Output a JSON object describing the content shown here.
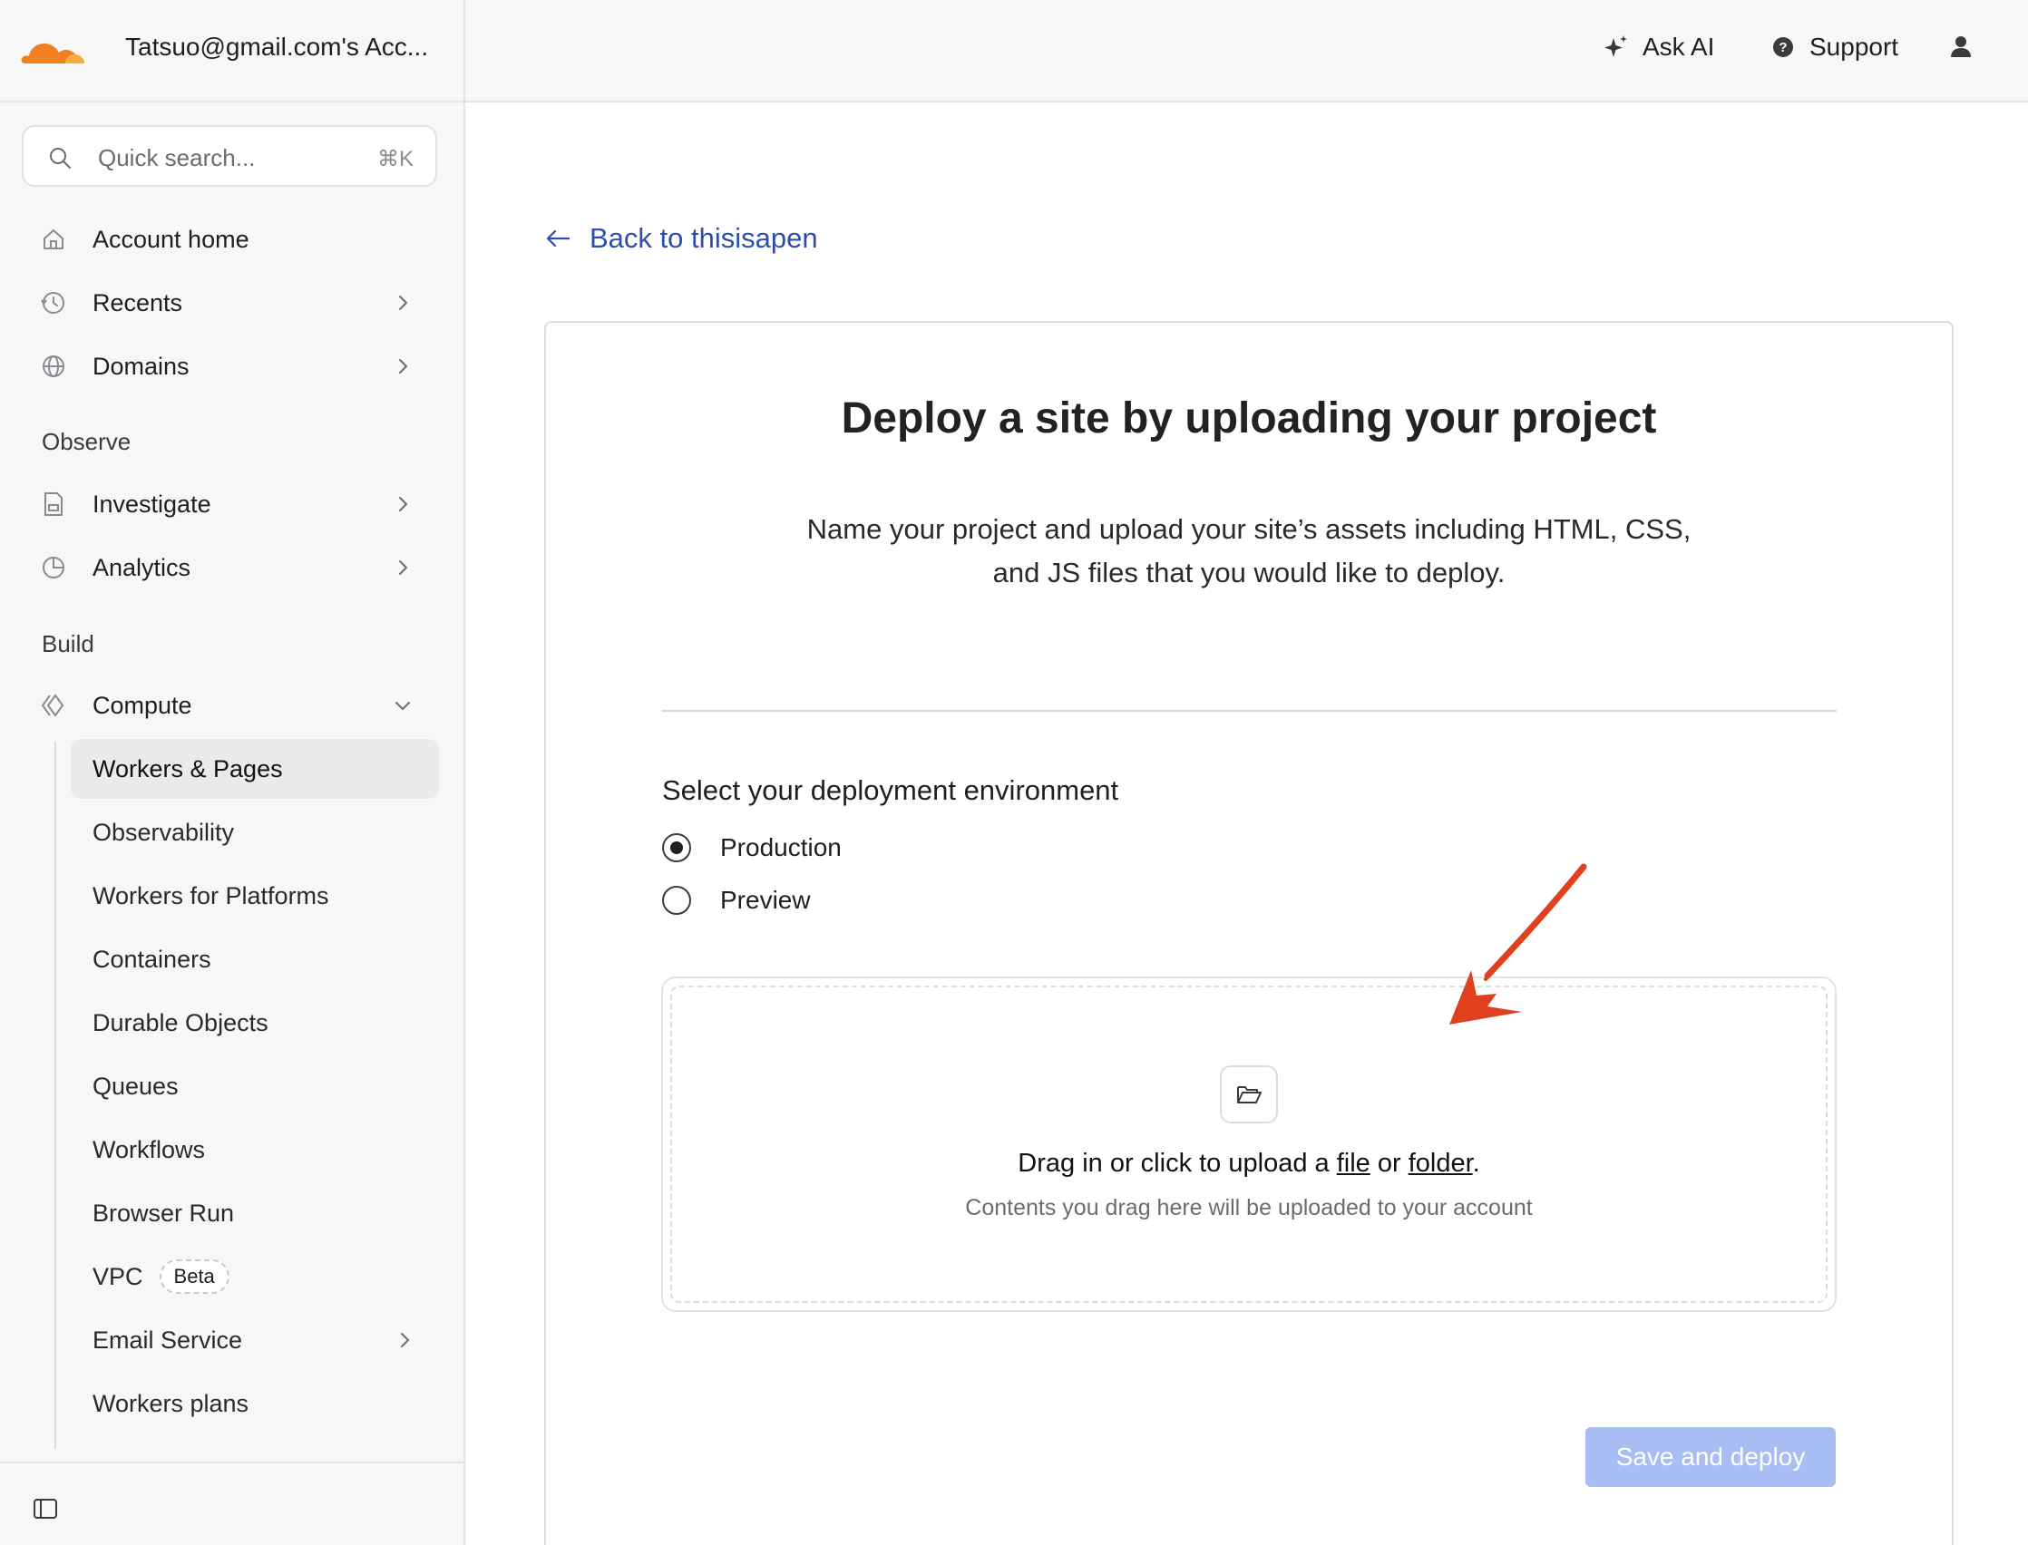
{
  "account": {
    "name": "Tatsuo@gmail.com's Acc..."
  },
  "search": {
    "placeholder": "Quick search...",
    "shortcut": "⌘K"
  },
  "nav": {
    "home": "Account home",
    "recents": "Recents",
    "domains": "Domains",
    "observe_label": "Observe",
    "investigate": "Investigate",
    "analytics": "Analytics",
    "build_label": "Build",
    "compute": "Compute",
    "compute_items": [
      {
        "label": "Workers & Pages"
      },
      {
        "label": "Observability"
      },
      {
        "label": "Workers for Platforms"
      },
      {
        "label": "Containers"
      },
      {
        "label": "Durable Objects"
      },
      {
        "label": "Queues"
      },
      {
        "label": "Workflows"
      },
      {
        "label": "Browser Run"
      },
      {
        "label": "VPC",
        "badge": "Beta"
      },
      {
        "label": "Email Service"
      },
      {
        "label": "Workers plans"
      }
    ]
  },
  "topbar": {
    "ask_ai": "Ask AI",
    "support": "Support"
  },
  "main": {
    "back": "Back to thisisapen",
    "title": "Deploy a site by uploading your project",
    "desc_line1": "Name your project and upload your site’s assets including HTML, CSS,",
    "desc_line2": "and JS files that you would like to deploy.",
    "env_label": "Select your deployment environment",
    "env_options": [
      "Production",
      "Preview"
    ],
    "env_selected": "Production",
    "drop_prefix": "Drag in or click to upload a ",
    "drop_file": "file",
    "drop_or": " or ",
    "drop_folder": "folder",
    "drop_suffix": ".",
    "drop_sub": "Contents you drag here will be uploaded to your account",
    "deploy_button": "Save and deploy"
  },
  "colors": {
    "brand_orange": "#f38020",
    "link_blue": "#2e4ea8",
    "button_disabled": "#a9bdf5",
    "annotation_red": "#e0401e"
  }
}
